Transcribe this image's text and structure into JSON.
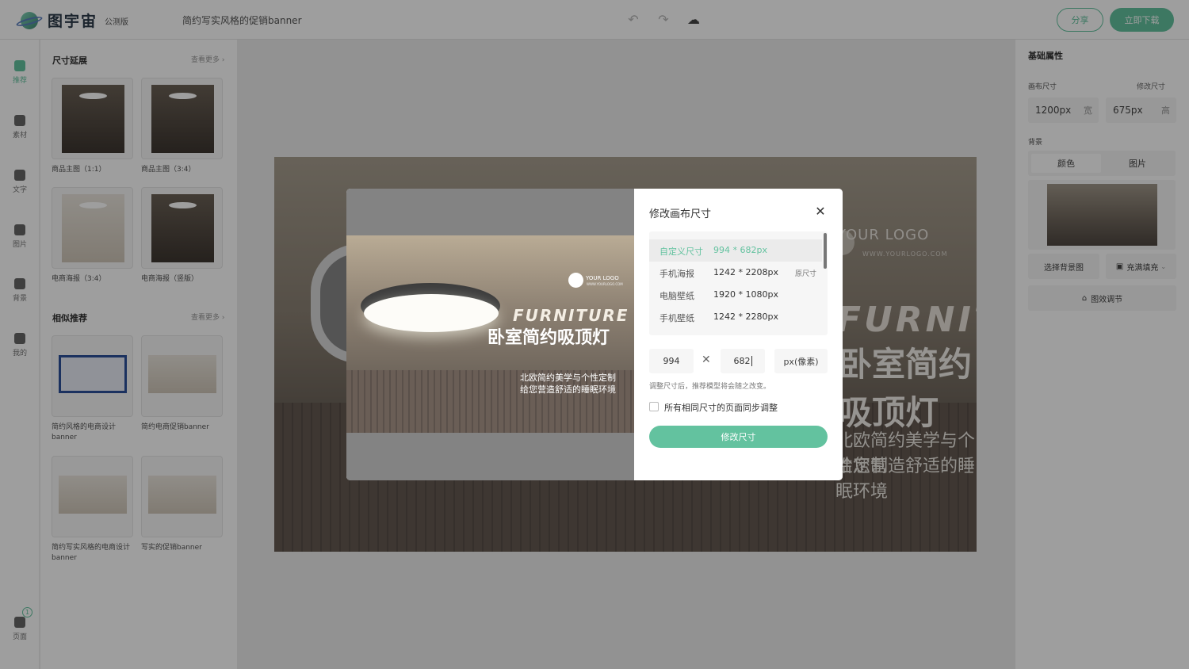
{
  "app": {
    "logo_text": "图宇宙",
    "beta_label": "公测版",
    "document_title": "简约写实风格的促销banner"
  },
  "toolbar": {
    "undo_icon": "undo-icon",
    "redo_icon": "redo-icon",
    "upload_icon": "cloud-upload-icon",
    "share_label": "分享",
    "download_label": "立即下载"
  },
  "rail": {
    "items": [
      {
        "label": "推荐",
        "icon": "recommend-icon",
        "active": true
      },
      {
        "label": "素材",
        "icon": "shapes-icon"
      },
      {
        "label": "文字",
        "icon": "text-icon"
      },
      {
        "label": "图片",
        "icon": "image-icon"
      },
      {
        "label": "背景",
        "icon": "background-icon"
      },
      {
        "label": "我的",
        "icon": "user-icon"
      }
    ],
    "pages_label": "页面",
    "pages_count": "1"
  },
  "left_panel": {
    "size_section": {
      "title": "尺寸延展",
      "more": "查看更多 ›",
      "items": [
        {
          "caption": "商品主图（1:1）"
        },
        {
          "caption": "商品主图（3:4）"
        },
        {
          "caption": "电商海报（3:4）"
        },
        {
          "caption": "电商海报（竖版）"
        }
      ]
    },
    "similar_section": {
      "title": "相似推荐",
      "more": "查看更多 ›",
      "items": [
        {
          "caption": "简约风格的电商设计banner"
        },
        {
          "caption": "简约电商促销banner"
        },
        {
          "caption": "简约写实风格的电商设计banner"
        },
        {
          "caption": "写实的促销banner"
        }
      ]
    }
  },
  "canvas": {
    "logo": "YOUR LOGO",
    "logo_url": "WWW.YOURLOGO.COM",
    "furniture": "FURNITURE",
    "headline": "卧室简约吸顶灯",
    "sub1": "北欧简约美学与个性定制",
    "sub2": "给您营造舒适的睡眠环境"
  },
  "right_panel": {
    "title": "基础属性",
    "canvas_size_label": "画布尺寸",
    "modify_size_link": "修改尺寸",
    "width_value": "1200px",
    "width_unit": "宽",
    "height_value": "675px",
    "height_unit": "高",
    "background_label": "背景",
    "tabs": [
      "颜色",
      "图片"
    ],
    "active_tab": 1,
    "choose_bg_label": "选择背景图",
    "fill_label": "充满填充",
    "adjust_label": "图效调节"
  },
  "dialog": {
    "title": "修改画布尺寸",
    "sizes": [
      {
        "name": "自定义尺寸",
        "value": "994 * 682px",
        "tag": "",
        "active": true
      },
      {
        "name": "手机海报",
        "value": "1242 * 2208px",
        "tag": "原尺寸"
      },
      {
        "name": "电脑壁纸",
        "value": "1920 * 1080px",
        "tag": ""
      },
      {
        "name": "手机壁纸",
        "value": "1242 * 2280px",
        "tag": ""
      }
    ],
    "width_input": "994",
    "height_input": "682",
    "unit": "px(像素)",
    "hint": "调整尺寸后，推荐模型将会随之改变。",
    "sync_label": "所有相同尺寸的页面同步调整",
    "sync_checked": false,
    "submit_label": "修改尺寸",
    "preview": {
      "logo": "YOUR LOGO",
      "logo_url": "WWW.YOURLOGO.COM",
      "furniture": "FURNITURE",
      "headline": "卧室简约吸顶灯",
      "sub1": "北欧简约美学与个性定制",
      "sub2": "给您营造舒适的睡眠环境"
    }
  },
  "colors": {
    "accent": "#63c29f",
    "overlay": "rgba(0,0,0,0.38)"
  }
}
